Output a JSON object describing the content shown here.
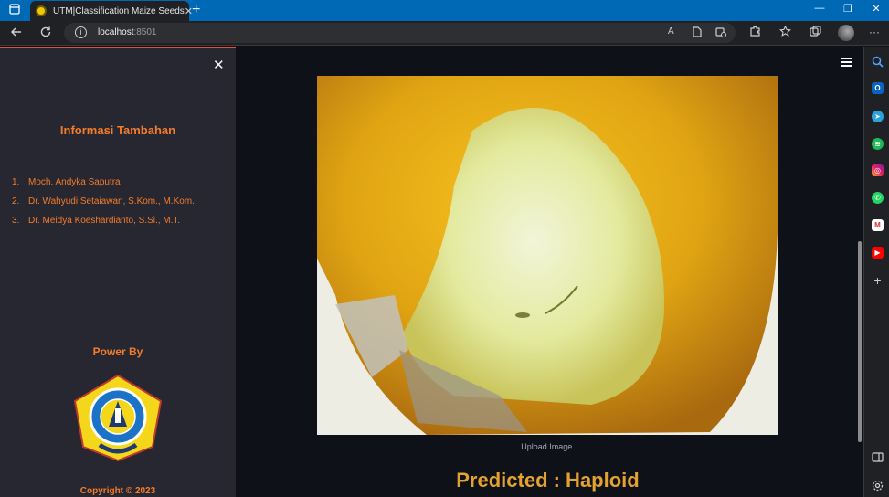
{
  "browser": {
    "tab_title": "UTM|Classification Maize Seeds",
    "tab_close": "✕",
    "new_tab": "+",
    "url_host": "localhost",
    "url_port": ":8501",
    "window_minimize": "—",
    "window_restore": "❐",
    "window_close": "✕",
    "more_menu": "···"
  },
  "sidebar": {
    "close": "✕",
    "info_heading": "Informasi Tambahan",
    "team": [
      {
        "num": "1.",
        "name": "Moch. Andyka Saputra"
      },
      {
        "num": "2.",
        "name": "Dr. Wahyudi Setaiawan, S.Kom., M.Kom."
      },
      {
        "num": "3.",
        "name": "Dr. Meidya Koeshardianto, S.Si., M.T."
      }
    ],
    "power_by": "Power By",
    "copyright": "Copyright © 2023"
  },
  "main": {
    "image_caption": "Upload Image.",
    "prediction": "Predicted : Haploid"
  },
  "colors": {
    "accent_orange": "#f47c2b",
    "prediction_gold": "#e3a12f",
    "browser_blue": "#0069b5",
    "sidebar_bg": "#262730",
    "main_bg": "#0e1117"
  }
}
